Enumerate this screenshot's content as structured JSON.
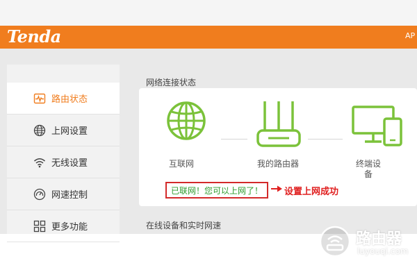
{
  "header": {
    "logo": "Tenda",
    "right_text": "AP"
  },
  "sidebar": {
    "items": [
      {
        "label": "路由状态",
        "icon": "pulse-icon",
        "active": true
      },
      {
        "label": "上网设置",
        "icon": "globe-icon",
        "active": false
      },
      {
        "label": "无线设置",
        "icon": "wifi-icon",
        "active": false
      },
      {
        "label": "网速控制",
        "icon": "speedometer-icon",
        "active": false
      },
      {
        "label": "更多功能",
        "icon": "grid-icon",
        "active": false
      }
    ]
  },
  "main": {
    "section_title": "网络连接状态",
    "devices": {
      "internet_label": "互联网",
      "router_label": "我的路由器",
      "terminal_label_line1": "终端设",
      "terminal_label_line2": "备"
    },
    "status_message": "已联网！您可以上网了！",
    "annotation": "设置上网成功",
    "section2_title": "在线设备和实时网速"
  },
  "watermark": {
    "text": "路由器",
    "url": "luyouqi.com"
  },
  "colors": {
    "brand_orange": "#f07d1e",
    "device_green": "#7bc23a",
    "status_green": "#2e9c2e",
    "annotation_red": "#e02020",
    "box_red": "#d32a2a"
  }
}
